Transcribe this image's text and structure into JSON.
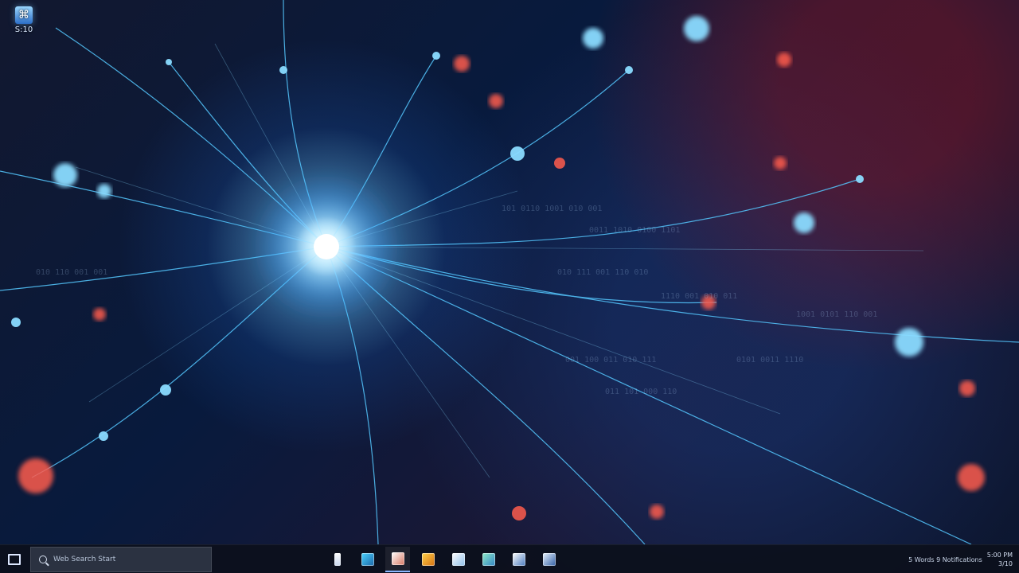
{
  "desktop": {
    "wallpaper": {
      "accent_colors": [
        "#79d2ff",
        "#2c7fff",
        "#ff4b3a",
        "#1b1734"
      ],
      "icon": "neural-network-wallpaper"
    },
    "icons": [
      {
        "label": "S:10",
        "icon": "app-shortcut-icon"
      }
    ]
  },
  "taskbar": {
    "start": {
      "icon": "start-icon"
    },
    "search": {
      "icon": "search-icon",
      "text": "Web Search Start"
    },
    "apps": [
      {
        "icon": "file-icon"
      },
      {
        "icon": "photo-app-icon"
      },
      {
        "icon": "image-editor-icon"
      },
      {
        "icon": "game-icon"
      },
      {
        "icon": "image-viewer-icon"
      },
      {
        "icon": "maps-icon"
      },
      {
        "icon": "photos-icon"
      },
      {
        "icon": "window-icon"
      }
    ],
    "tray": {
      "text": "5 Words 9 Notifications",
      "time": "5:00 PM",
      "date": "3/10"
    }
  }
}
